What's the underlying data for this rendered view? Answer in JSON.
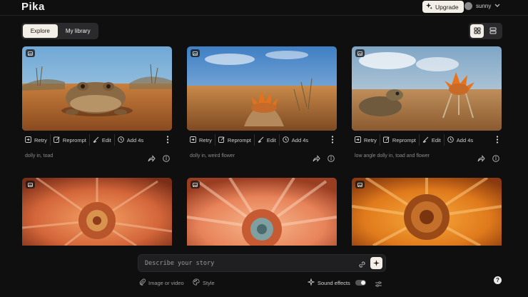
{
  "header": {
    "logo": "Pika",
    "upgrade_label": "Upgrade",
    "username": "sunny"
  },
  "tabs": [
    {
      "label": "Explore",
      "active": true
    },
    {
      "label": "My library",
      "active": false
    }
  ],
  "view_toggle": {
    "selected": "grid"
  },
  "card_actions": {
    "retry": "Retry",
    "reprompt": "Reprompt",
    "edit": "Edit",
    "add": "Add 4s"
  },
  "cards": [
    {
      "prompt": "dolly in, toad",
      "scene": "toad in desert"
    },
    {
      "prompt": "dolly in, weird flower",
      "scene": "orange spiky flower in desert"
    },
    {
      "prompt": "low angle dolly in, toad and flower",
      "scene": "toad and flower in desert"
    },
    {
      "prompt": "",
      "scene": "orange dahlia close-up"
    },
    {
      "prompt": "",
      "scene": "peach dahlia close-up"
    },
    {
      "prompt": "",
      "scene": "orange sunflower-like bloom"
    }
  ],
  "composer": {
    "placeholder": "Describe your story",
    "image_or_video": "Image or video",
    "style": "Style",
    "sound_effects": "Sound effects",
    "sound_effects_on": true
  },
  "help_label": "?",
  "colors": {
    "background": "#0f0f10",
    "accent": "#f4efe6",
    "panel": "#2a2a2c"
  }
}
